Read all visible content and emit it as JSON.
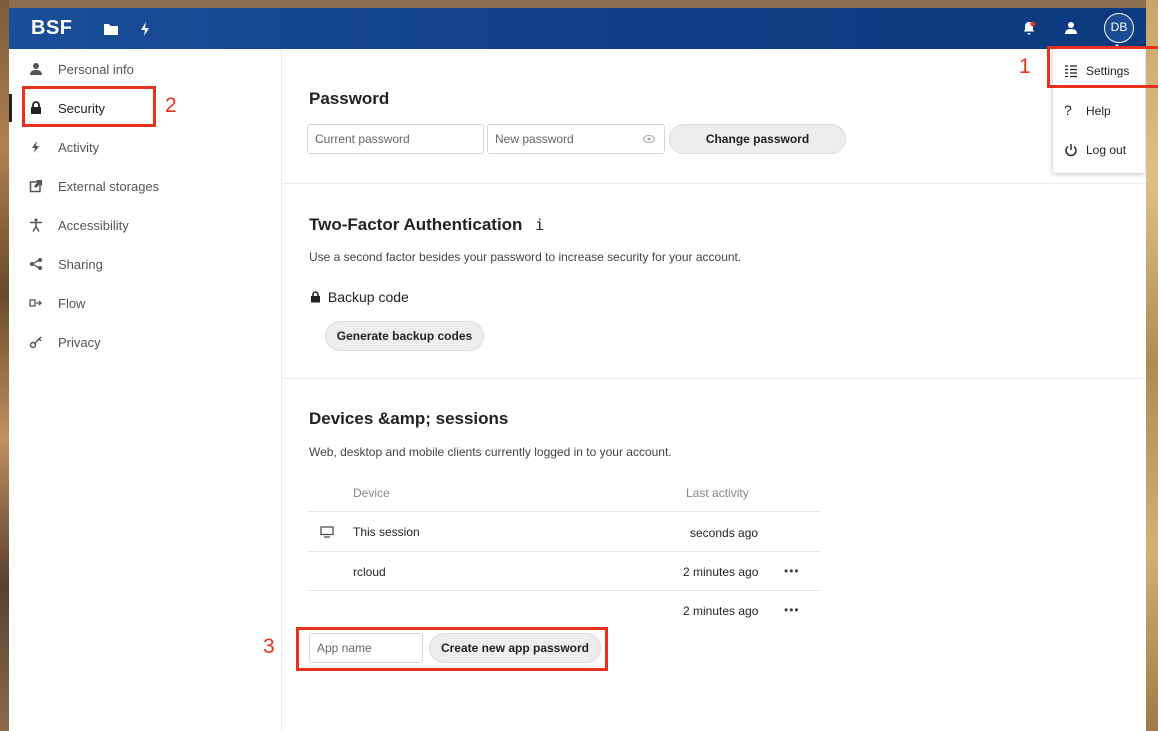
{
  "app": {
    "logo": "BSF",
    "avatar_initials": "DB"
  },
  "topbar": {
    "app_icons": [
      "folder-icon",
      "activity-bolt-icon"
    ],
    "right_icons": [
      "notifications-icon",
      "contacts-icon"
    ]
  },
  "sidebar": {
    "items": [
      {
        "label": "Personal info",
        "icon": "person-icon"
      },
      {
        "label": "Security",
        "icon": "lock-icon"
      },
      {
        "label": "Activity",
        "icon": "bolt-icon"
      },
      {
        "label": "External storages",
        "icon": "external-link-icon"
      },
      {
        "label": "Accessibility",
        "icon": "accessibility-icon"
      },
      {
        "label": "Sharing",
        "icon": "share-icon"
      },
      {
        "label": "Flow",
        "icon": "flow-icon"
      },
      {
        "label": "Privacy",
        "icon": "key-icon"
      }
    ],
    "active": "Security"
  },
  "password": {
    "title": "Password",
    "current_placeholder": "Current password",
    "new_placeholder": "New password",
    "change_label": "Change password"
  },
  "twofactor": {
    "title": "Two-Factor Authentication",
    "info_glyph": "i",
    "description": "Use a second factor besides your password to increase security for your account.",
    "backup_label": "Backup code",
    "generate_label": "Generate backup codes"
  },
  "devices": {
    "title": "Devices &amp; sessions",
    "description": "Web, desktop and mobile clients currently logged in to your account.",
    "col_device": "Device",
    "col_activity": "Last activity",
    "rows": [
      {
        "name": "This session",
        "activity": "seconds ago",
        "icon": "monitor-icon",
        "menu": ""
      },
      {
        "name": "rcloud",
        "activity": "2 minutes ago",
        "icon": "",
        "menu": "•••"
      },
      {
        "name": "",
        "activity": "2 minutes ago",
        "icon": "",
        "menu": "•••"
      }
    ],
    "app_name_placeholder": "App name",
    "create_label": "Create new app password"
  },
  "user_menu": {
    "items": [
      {
        "label": "Settings",
        "icon": "settings-list-icon"
      },
      {
        "label": "Help",
        "icon": "help-icon"
      },
      {
        "label": "Log out",
        "icon": "power-icon"
      }
    ]
  },
  "annotations": {
    "n1": "1",
    "n2": "2",
    "n3": "3",
    "color": "#e8321e"
  },
  "colors": {
    "topbar": "#0f3f87",
    "accent": "#e8321e"
  }
}
